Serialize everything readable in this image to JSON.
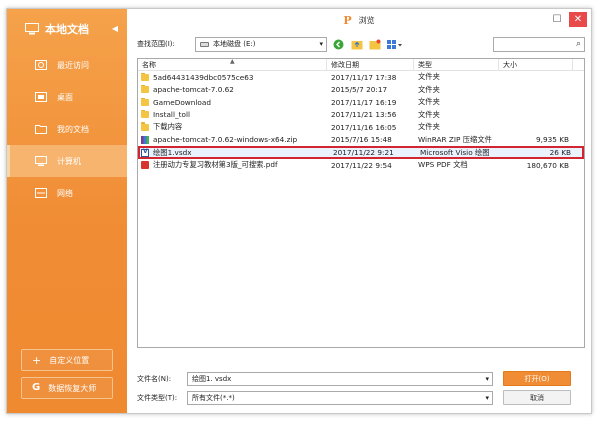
{
  "sidebar": {
    "title": "本地文档",
    "collapse_glyph": "◀",
    "items": [
      {
        "label": "最近访问",
        "icon": "recent-icon"
      },
      {
        "label": "桌面",
        "icon": "desktop-icon"
      },
      {
        "label": "我的文档",
        "icon": "my-documents-icon"
      },
      {
        "label": "计算机",
        "icon": "computer-icon",
        "active": true
      },
      {
        "label": "网络",
        "icon": "network-icon"
      }
    ],
    "custom_location": "自定义位置",
    "data_recovery": "数据恢复大师"
  },
  "window": {
    "brand_glyph": "P",
    "title": "浏览",
    "max_glyph": "☐",
    "close_glyph": "✕"
  },
  "toolbar": {
    "lookin_label": "查找范围(I):",
    "lookin_value": "本地磁盘 (E:)",
    "dropdown_glyph": "▾"
  },
  "columns": {
    "name": "名称",
    "date": "修改日期",
    "type": "类型",
    "size": "大小",
    "sort_glyph": "▲"
  },
  "files": [
    {
      "name": "5ad64431439dbc0575ce63",
      "date": "2017/11/17 17:38",
      "type": "文件夹",
      "size": "",
      "kind": "folder"
    },
    {
      "name": "apache-tomcat-7.0.62",
      "date": "2015/5/7 20:17",
      "type": "文件夹",
      "size": "",
      "kind": "folder"
    },
    {
      "name": "GameDownload",
      "date": "2017/11/17 16:19",
      "type": "文件夹",
      "size": "",
      "kind": "folder"
    },
    {
      "name": "Install_toll",
      "date": "2017/11/21 13:56",
      "type": "文件夹",
      "size": "",
      "kind": "folder"
    },
    {
      "name": "下载内容",
      "date": "2017/11/16 16:05",
      "type": "文件夹",
      "size": "",
      "kind": "folder"
    },
    {
      "name": "apache-tomcat-7.0.62-windows-x64.zip",
      "date": "2015/7/16 15:48",
      "type": "WinRAR ZIP 压缩文件",
      "size": "9,935 KB",
      "kind": "zip"
    },
    {
      "name": "绘图1.vsdx",
      "date": "2017/11/22 9:21",
      "type": "Microsoft Visio 绘图",
      "size": "26 KB",
      "kind": "visio",
      "selected": true
    },
    {
      "name": "注册动力专复习教材第3版_可搜索.pdf",
      "date": "2017/11/22 9:54",
      "type": "WPS PDF 文档",
      "size": "180,670 KB",
      "kind": "pdf"
    }
  ],
  "footer": {
    "filename_label": "文件名(N):",
    "filename_value": "绘图1. vsdx",
    "filetype_label": "文件类型(T):",
    "filetype_value": "所有文件(*.*)",
    "open_label": "打开(O)",
    "cancel_label": "取消"
  },
  "colors": {
    "accent": "#f08c34",
    "selection_border": "#d32531",
    "close": "#e84a4a"
  }
}
